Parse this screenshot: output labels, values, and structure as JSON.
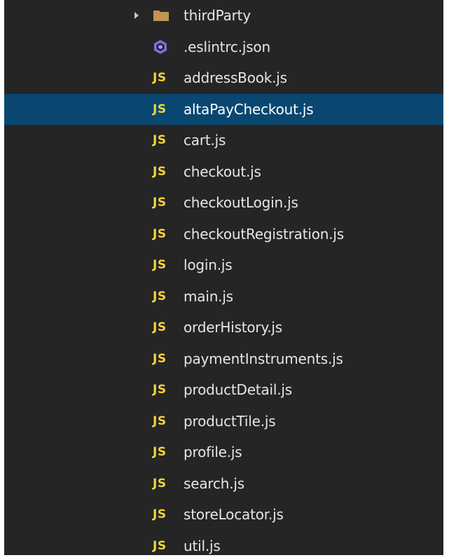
{
  "explorer": {
    "items": [
      {
        "label": "thirdParty",
        "icon": "folder-icon",
        "type": "folder"
      },
      {
        "label": ".eslintrc.json",
        "icon": "eslint-icon",
        "type": "eslint"
      },
      {
        "label": "addressBook.js",
        "icon": "js-file-icon",
        "icon_text": "JS",
        "type": "js"
      },
      {
        "label": "altaPayCheckout.js",
        "icon": "js-file-icon",
        "icon_text": "JS",
        "type": "js",
        "selected": true
      },
      {
        "label": "cart.js",
        "icon": "js-file-icon",
        "icon_text": "JS",
        "type": "js"
      },
      {
        "label": "checkout.js",
        "icon": "js-file-icon",
        "icon_text": "JS",
        "type": "js"
      },
      {
        "label": "checkoutLogin.js",
        "icon": "js-file-icon",
        "icon_text": "JS",
        "type": "js"
      },
      {
        "label": "checkoutRegistration.js",
        "icon": "js-file-icon",
        "icon_text": "JS",
        "type": "js"
      },
      {
        "label": "login.js",
        "icon": "js-file-icon",
        "icon_text": "JS",
        "type": "js"
      },
      {
        "label": "main.js",
        "icon": "js-file-icon",
        "icon_text": "JS",
        "type": "js"
      },
      {
        "label": "orderHistory.js",
        "icon": "js-file-icon",
        "icon_text": "JS",
        "type": "js"
      },
      {
        "label": "paymentInstruments.js",
        "icon": "js-file-icon",
        "icon_text": "JS",
        "type": "js"
      },
      {
        "label": "productDetail.js",
        "icon": "js-file-icon",
        "icon_text": "JS",
        "type": "js"
      },
      {
        "label": "productTile.js",
        "icon": "js-file-icon",
        "icon_text": "JS",
        "type": "js"
      },
      {
        "label": "profile.js",
        "icon": "js-file-icon",
        "icon_text": "JS",
        "type": "js"
      },
      {
        "label": "search.js",
        "icon": "js-file-icon",
        "icon_text": "JS",
        "type": "js"
      },
      {
        "label": "storeLocator.js",
        "icon": "js-file-icon",
        "icon_text": "JS",
        "type": "js"
      },
      {
        "label": "util.js",
        "icon": "js-file-icon",
        "icon_text": "JS",
        "type": "js"
      }
    ]
  },
  "colors": {
    "background": "#252526",
    "selection": "#094771",
    "js_icon": "#f0d53c",
    "folder_icon": "#c09553",
    "eslint_icon": "#7a6fe5",
    "text": "#e6e6e6"
  }
}
